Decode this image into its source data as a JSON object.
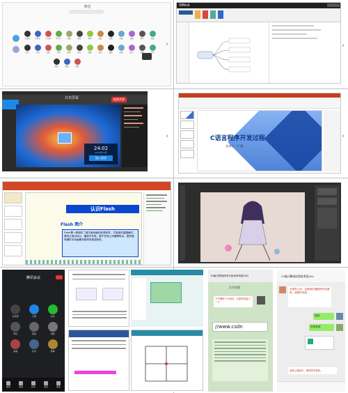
{
  "p1": {
    "title": "微信",
    "avatar_row1_names": [
      "王语嫣",
      "冯昊天",
      "小红帽",
      "李小华",
      "刘敏",
      "张晓",
      "陈明",
      "赵云",
      "孙丽",
      "周强",
      "吴越",
      "郑华",
      "王磊"
    ],
    "avatar_row2_names": [
      "罗欣",
      "许诺",
      "何静",
      "马超",
      "朱丽",
      "胡军",
      "林峰",
      "高洁",
      "梁爽",
      "宋雨",
      "唐宁",
      "韩梅",
      "冯伟"
    ],
    "avatar_row3_names": [
      "黄蕾",
      "曹阳",
      "彭程"
    ]
  },
  "p2": {
    "app_title": "XMind",
    "node_central": "中心主题",
    "nodes": [
      "分支主题 1",
      "分支主题 2",
      "分支主题 3",
      "分支主题 4"
    ]
  },
  "p3": {
    "title": "共享屏幕",
    "stop_label": "结束共享",
    "clock": "24:02",
    "date": "2021年10月",
    "join_button": "加入会议"
  },
  "p4": {
    "slide_title": "C语言程序开发过程",
    "presenter": "主讲人：丁 强"
  },
  "p5": {
    "header": "认识Flash",
    "subheader": "Flash 简介",
    "body": "Flash是一款制作二维平面动画的优秀软件，它能用矢量图格式，具有占用空间小、播放不失真、便于在网上传播等特点，是多媒体课件中动画素材制作的首选软件。"
  },
  "p7": {
    "title": "腾讯会议",
    "names": [
      "张老师",
      "王明",
      "刘华",
      "李红",
      "陈静",
      "周刚",
      "赵敏",
      "孙涛",
      "吴琳"
    ],
    "bottom_items": [
      "静音",
      "视频",
      "共享",
      "成员",
      "更多"
    ]
  },
  "p9": {
    "title": "19级计算机科学与技术本科班(56)",
    "url_text": "//www.csdn",
    "msg_title": "文字标题",
    "msg_text": "下节课来个小测试，大家好好复习一下"
  },
  "p10": {
    "title": "21级计算机应用技术班(54)",
    "bubble1": "大家早上好，这是我们课程的作业要求，请按时完成。",
    "bubble2": "收到",
    "bubble3": "好的老师",
    "bubble4": "这是上课讲义，请同学们查收。"
  }
}
